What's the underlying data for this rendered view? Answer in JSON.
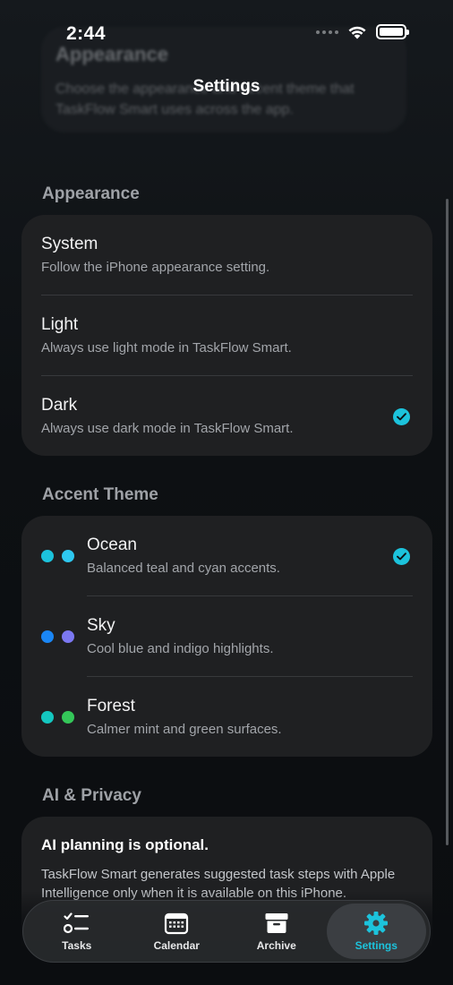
{
  "status": {
    "time": "2:44"
  },
  "nav": {
    "title": "Settings"
  },
  "ghost": {
    "title": "Appearance",
    "text": "Choose the appearance and accent theme that TaskFlow Smart uses across the app."
  },
  "appearance": {
    "header": "Appearance",
    "options": [
      {
        "title": "System",
        "subtitle": "Follow the iPhone appearance setting.",
        "selected": false
      },
      {
        "title": "Light",
        "subtitle": "Always use light mode in TaskFlow Smart.",
        "selected": false
      },
      {
        "title": "Dark",
        "subtitle": "Always use dark mode in TaskFlow Smart.",
        "selected": true
      }
    ]
  },
  "accent": {
    "header": "Accent Theme",
    "options": [
      {
        "title": "Ocean",
        "subtitle": "Balanced teal and cyan accents.",
        "colors": [
          "#1cc3dc",
          "#2ec8f0"
        ],
        "selected": true
      },
      {
        "title": "Sky",
        "subtitle": "Cool blue and indigo highlights.",
        "colors": [
          "#1a86f5",
          "#7b78f2"
        ],
        "selected": false
      },
      {
        "title": "Forest",
        "subtitle": "Calmer mint and green surfaces.",
        "colors": [
          "#14c7c0",
          "#34c759"
        ],
        "selected": false
      }
    ]
  },
  "ai": {
    "header": "AI & Privacy",
    "title": "AI planning is optional.",
    "body": "TaskFlow Smart generates suggested task steps with Apple Intelligence only when it is available on this iPhone."
  },
  "tabbar": {
    "tabs": [
      {
        "label": "Tasks",
        "icon": "checklist-icon",
        "active": false
      },
      {
        "label": "Calendar",
        "icon": "calendar-icon",
        "active": false
      },
      {
        "label": "Archive",
        "icon": "archive-box-icon",
        "active": false
      },
      {
        "label": "Settings",
        "icon": "gear-icon",
        "active": true
      }
    ]
  },
  "colors": {
    "accent": "#1cc3dc",
    "card": "#1f2022",
    "background": "#0d1013"
  }
}
